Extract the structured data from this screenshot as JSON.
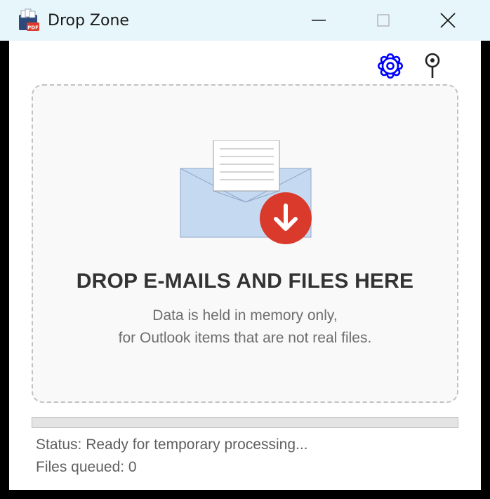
{
  "window": {
    "title": "Drop Zone",
    "app_icon": "pdf-stack-icon",
    "icon_badge": "PDF",
    "controls": [
      "minimize-icon",
      "maximize-icon",
      "close-icon"
    ]
  },
  "toolbar": {
    "settings_icon": "gear-icon",
    "pin_icon": "pin-icon",
    "gear_color": "#0000ff"
  },
  "dropzone": {
    "illustration": "envelope-download-icon",
    "title": "DROP E-MAILS AND FILES HERE",
    "subtitle_line1": "Data is held in memory only,",
    "subtitle_line2": "for Outlook items that are not real files."
  },
  "progress": {
    "value_percent": 0
  },
  "status": {
    "line1": "Status: Ready for temporary processing...",
    "line2": "Files queued: 0"
  },
  "colors": {
    "titlebar_bg": "#e6f6fa",
    "accent_red": "#d93a2b",
    "envelope_fill": "#c5d9f1"
  }
}
